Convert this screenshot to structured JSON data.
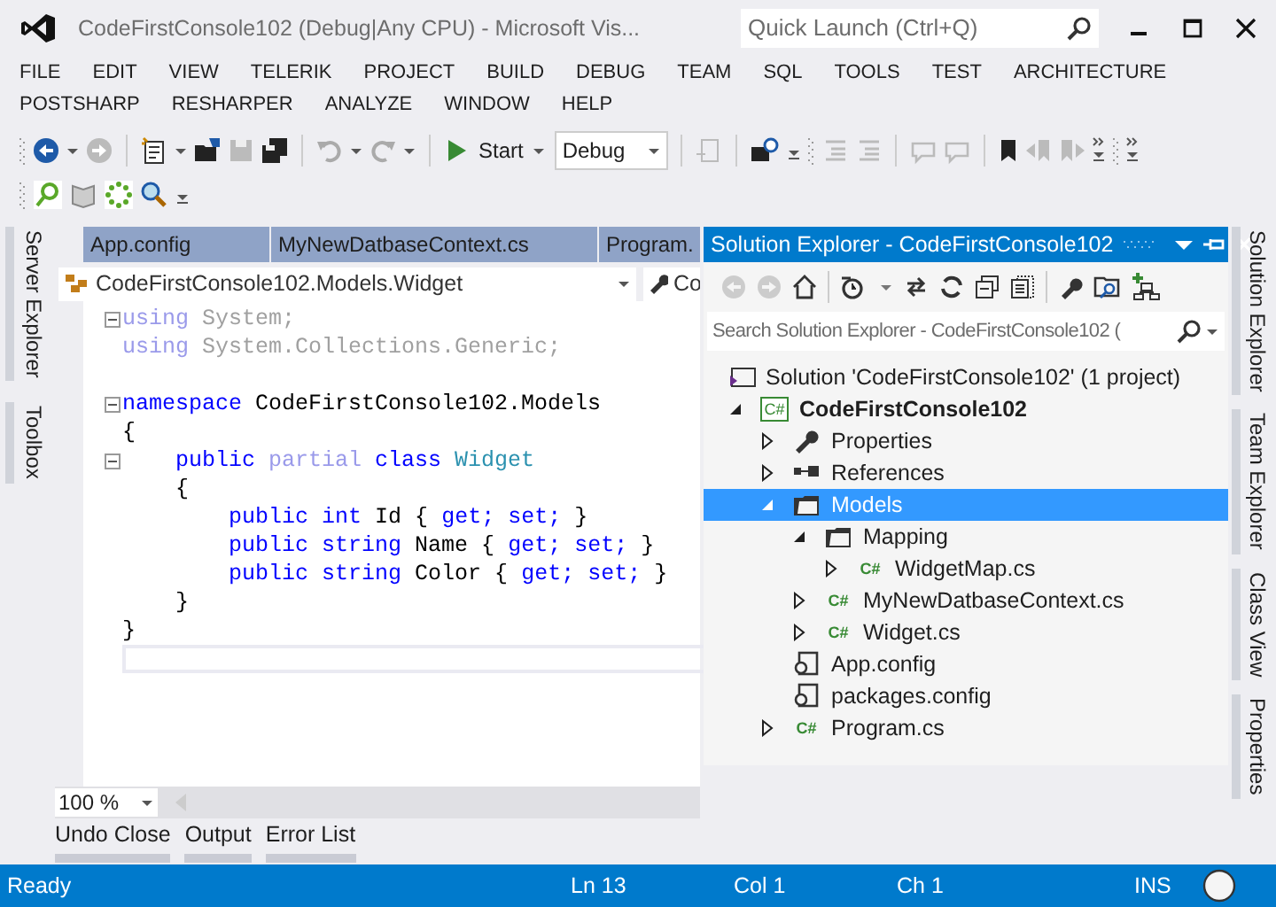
{
  "window": {
    "title": "CodeFirstConsole102 (Debug|Any CPU) - Microsoft Vis...",
    "quick_launch": {
      "placeholder": "Quick Launch (Ctrl+Q)"
    }
  },
  "menu_rows": [
    [
      "FILE",
      "EDIT",
      "VIEW",
      "TELERIK",
      "PROJECT",
      "BUILD",
      "DEBUG",
      "TEAM",
      "SQL",
      "TOOLS",
      "TEST",
      "ARCHITECTURE"
    ],
    [
      "POSTSHARP",
      "RESHARPER",
      "ANALYZE",
      "WINDOW",
      "HELP"
    ]
  ],
  "toolbar": {
    "start_button": "Start",
    "configuration": "Debug"
  },
  "left_tabs": [
    "Server Explorer",
    "Toolbox"
  ],
  "right_tabs": [
    "Solution Explorer",
    "Team Explorer",
    "Class View",
    "Properties"
  ],
  "document_tabs": [
    {
      "label": "App.config",
      "selected": false
    },
    {
      "label": "MyNewDatbaseContext.cs",
      "selected": false
    },
    {
      "label": "Program.",
      "selected": false
    }
  ],
  "navigation_bar": {
    "type_dropdown": "CodeFirstConsole102.Models.Widget",
    "member_dropdown": "Co"
  },
  "code_lines": [
    {
      "fold": true,
      "tokens": [
        {
          "t": "using",
          "kind": "dim_keyword"
        },
        {
          "t": " System;",
          "kind": "dim"
        }
      ]
    },
    {
      "fold": false,
      "tokens": [
        {
          "t": "using",
          "kind": "dim_keyword"
        },
        {
          "t": " System.Collections.Generic;",
          "kind": "dim"
        }
      ]
    },
    {
      "fold": false
    },
    {
      "fold": true,
      "tokens": [
        {
          "t": "namespace",
          "kind": "keyword"
        },
        {
          "t": " CodeFirstConsole102.Models",
          "kind": "plain"
        }
      ]
    },
    {
      "fold": false,
      "tokens": [
        {
          "t": "{",
          "kind": "plain"
        }
      ]
    },
    {
      "fold": true,
      "tokens": [
        {
          "t": "    public ",
          "kind": "keyword"
        },
        {
          "t": "partial",
          "kind": "dim_keyword"
        },
        {
          "t": " class",
          "kind": "keyword"
        },
        {
          "t": " Widget",
          "kind": "type"
        }
      ]
    },
    {
      "fold": false,
      "tokens": [
        {
          "t": "    {",
          "kind": "brace"
        }
      ]
    },
    {
      "fold": false,
      "tokens": [
        {
          "t": "        public int",
          "kind": "keyword"
        },
        {
          "t": " Id ",
          "kind": "plain"
        },
        {
          "t": "{",
          "kind": "brace"
        },
        {
          "t": " get; set; ",
          "kind": "keyword"
        },
        {
          "t": "}",
          "kind": "brace"
        }
      ]
    },
    {
      "fold": false,
      "tokens": [
        {
          "t": "        public string",
          "kind": "keyword"
        },
        {
          "t": " Name ",
          "kind": "plain"
        },
        {
          "t": "{",
          "kind": "brace"
        },
        {
          "t": " get; set; ",
          "kind": "keyword"
        },
        {
          "t": "}",
          "kind": "brace"
        }
      ]
    },
    {
      "fold": false,
      "tokens": [
        {
          "t": "        public string",
          "kind": "keyword"
        },
        {
          "t": " Color ",
          "kind": "plain"
        },
        {
          "t": "{",
          "kind": "brace"
        },
        {
          "t": " get; set; ",
          "kind": "keyword"
        },
        {
          "t": "}",
          "kind": "brace"
        }
      ]
    },
    {
      "fold": false,
      "tokens": [
        {
          "t": "    }",
          "kind": "brace"
        }
      ]
    },
    {
      "fold": false,
      "tokens": [
        {
          "t": "}",
          "kind": "brace"
        }
      ]
    },
    {
      "fold": false,
      "current": true
    }
  ],
  "zoom": "100 %",
  "solution_explorer": {
    "title": "Solution Explorer - CodeFirstConsole102",
    "search": {
      "placeholder": "Search Solution Explorer - CodeFirstConsole102 ("
    },
    "solution": "Solution 'CodeFirstConsole102' (1 project)",
    "tree": [
      {
        "label": "CodeFirstConsole102",
        "kind": "project",
        "icon_label": "C#",
        "expanded": true,
        "selected": false,
        "children": [
          {
            "label": "Properties",
            "kind": "properties",
            "expanded": false,
            "selected": false
          },
          {
            "label": "References",
            "kind": "references",
            "expanded": false,
            "selected": false
          },
          {
            "label": "Models",
            "kind": "folder",
            "expanded": true,
            "selected": true,
            "children": [
              {
                "label": "Mapping",
                "kind": "folder",
                "expanded": true,
                "selected": false,
                "children": [
                  {
                    "label": "WidgetMap.cs",
                    "kind": "csharp",
                    "icon_label": "C#",
                    "expanded": false,
                    "selected": false
                  }
                ]
              },
              {
                "label": "MyNewDatbaseContext.cs",
                "kind": "csharp",
                "icon_label": "C#",
                "expanded": false,
                "selected": false
              },
              {
                "label": "Widget.cs",
                "kind": "csharp",
                "icon_label": "C#",
                "expanded": false,
                "selected": false
              }
            ]
          },
          {
            "label": "App.config",
            "kind": "config",
            "selected": false
          },
          {
            "label": "packages.config",
            "kind": "config",
            "selected": false
          },
          {
            "label": "Program.cs",
            "kind": "csharp",
            "icon_label": "C#",
            "expanded": false,
            "selected": false
          }
        ]
      }
    ]
  },
  "bottom_tabs": [
    "Undo Close",
    "Output",
    "Error List"
  ],
  "status_bar": {
    "message": "Ready",
    "line": "Ln 13",
    "column": "Col 1",
    "char": "Ch 1",
    "mode": "INS"
  }
}
